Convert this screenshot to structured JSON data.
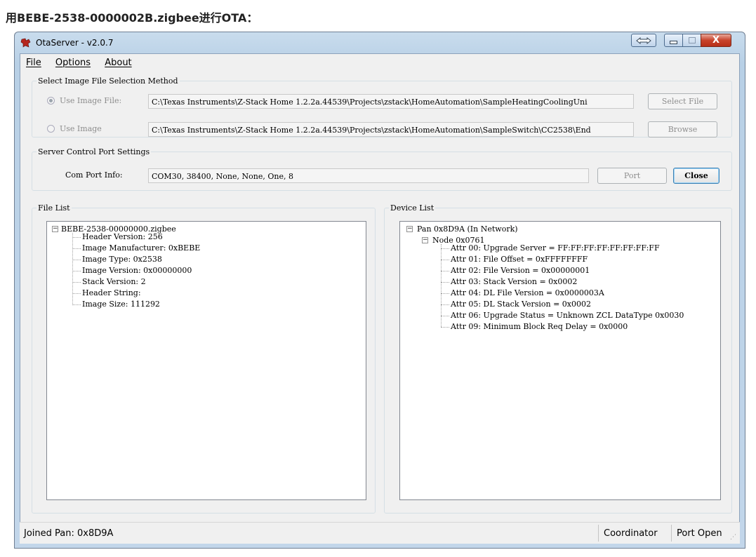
{
  "caption": "用BEBE-2538-0000002B.zigbee进行OTA：",
  "window": {
    "title": "OtaServer - v2.0.7",
    "close_glyph": "X"
  },
  "menu": {
    "file": "File",
    "options": "Options",
    "about": "About"
  },
  "image_selection": {
    "legend": "Select Image File Selection Method",
    "option1_label": "Use Image File:",
    "option1_path": "C:\\Texas Instruments\\Z-Stack Home 1.2.2a.44539\\Projects\\zstack\\HomeAutomation\\SampleHeatingCoolingUni",
    "option1_button": "Select File",
    "option1_checked": true,
    "option2_label": "Use Image",
    "option2_path": "C:\\Texas Instruments\\Z-Stack Home 1.2.2a.44539\\Projects\\zstack\\HomeAutomation\\SampleSwitch\\CC2538\\End",
    "option2_button": "Browse"
  },
  "server_control": {
    "legend": "Server Control Port Settings",
    "label": "Com Port Info:",
    "value": "COM30, 38400, None, None, One, 8",
    "port_button": "Port",
    "close_button": "Close"
  },
  "file_list": {
    "legend": "File List",
    "root": "BEBE-2538-00000000.zigbee",
    "children": [
      "Header Version: 256",
      "Image Manufacturer: 0xBEBE",
      "Image Type: 0x2538",
      "Image Version: 0x00000000",
      "Stack Version: 2",
      "Header String:",
      "Image Size: 111292"
    ]
  },
  "device_list": {
    "legend": "Device List",
    "root": "Pan 0x8D9A (In Network)",
    "node": "Node 0x0761",
    "attrs": [
      "Attr 00: Upgrade Server = FF:FF:FF:FF:FF:FF:FF:FF",
      "Attr 01: File Offset = 0xFFFFFFFF",
      "Attr 02: File Version = 0x00000001",
      "Attr 03: Stack Version = 0x0002",
      "Attr 04: DL File Version = 0x0000003A",
      "Attr 05: DL Stack Version = 0x0002",
      "Attr 06: Upgrade Status = Unknown ZCL DataType 0x0030",
      "Attr 09: Minimum Block Req Delay = 0x0000"
    ]
  },
  "statusbar": {
    "joined": "Joined Pan: 0x8D9A",
    "role": "Coordinator",
    "port": "Port Open"
  }
}
